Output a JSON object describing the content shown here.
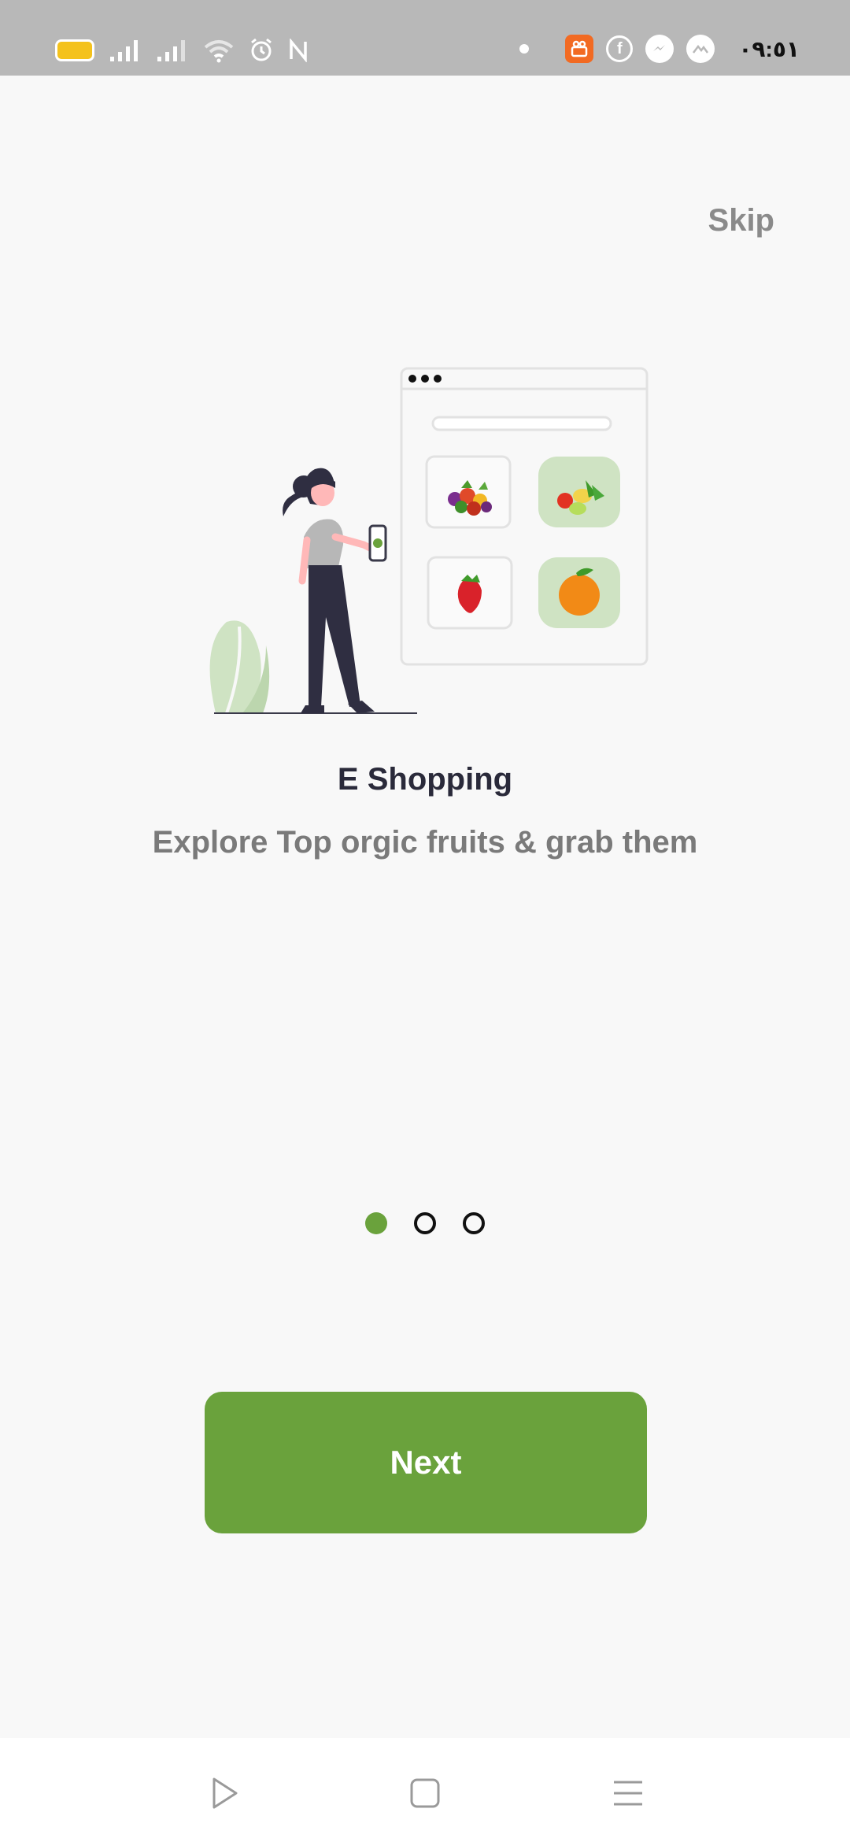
{
  "status_bar": {
    "time": "٠٩:٥١",
    "icons": [
      "battery-icon",
      "signal-icon",
      "signal-icon",
      "wifi-icon",
      "alarm-icon",
      "nfc-icon",
      "notification-dot",
      "app-icon",
      "facebook-icon",
      "messenger-icon",
      "app-icon"
    ]
  },
  "onboarding": {
    "skip_label": "Skip",
    "title": "E Shopping",
    "subtitle": "Explore Top orgic fruits &  grab them",
    "page_index": 0,
    "page_count": 3,
    "next_label": "Next"
  },
  "navigation_bar": {
    "buttons": [
      "back-icon",
      "home-icon",
      "menu-icon"
    ]
  },
  "colors": {
    "accent": "#6aa23c",
    "status_bar_bg": "#b8b8b8",
    "background": "#f8f8f8",
    "title": "#2a2a3a",
    "subtitle": "#7a7a7a",
    "skip": "#8a8a8a"
  }
}
